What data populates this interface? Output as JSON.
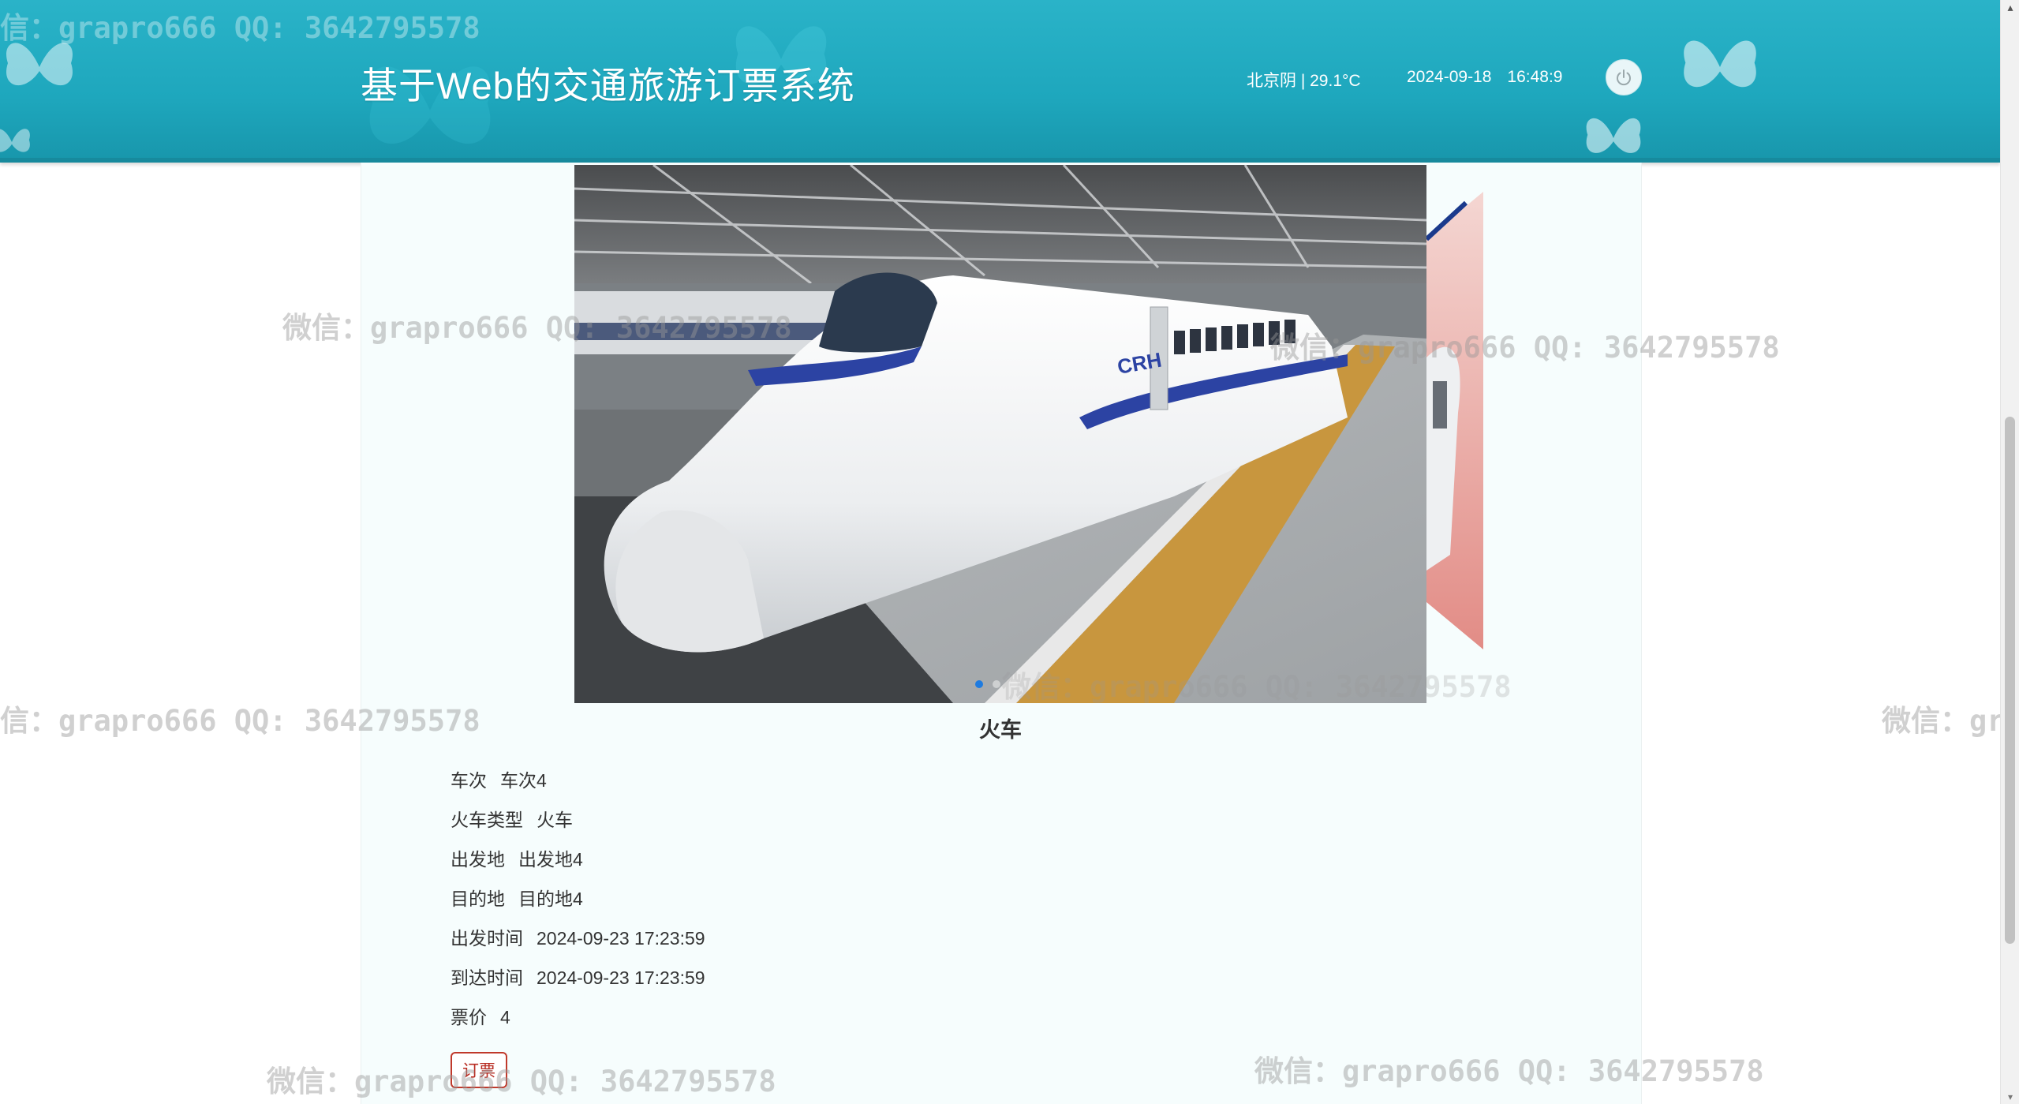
{
  "header": {
    "title": "基于Web的交通旅游订票系统",
    "weather": "北京阴 | 29.1°C",
    "date": "2024-09-18",
    "time": "16:48:9",
    "power_icon": "power-icon"
  },
  "carousel": {
    "active_index": 0,
    "slide_count": 3,
    "caption": "火车"
  },
  "details": [
    {
      "label": "车次",
      "value": "车次4"
    },
    {
      "label": "火车类型",
      "value": "火车"
    },
    {
      "label": "出发地",
      "value": "出发地4"
    },
    {
      "label": "目的地",
      "value": "目的地4"
    },
    {
      "label": "出发时间",
      "value": "2024-09-23 17:23:59"
    },
    {
      "label": "到达时间",
      "value": "2024-09-23 17:23:59"
    },
    {
      "label": "票价",
      "value": "4"
    }
  ],
  "actions": {
    "book_label": "订票"
  },
  "watermark": {
    "text": "微信：grapro666 QQ: 3642795578",
    "partial_left": "信：grapro666 QQ: 3642795578",
    "partial_right": "微信：gr"
  },
  "colors": {
    "header": "#1ea7bd",
    "panel": "#f6fdfd",
    "book_border": "#c0392b",
    "dot_active": "#1e7be0"
  }
}
